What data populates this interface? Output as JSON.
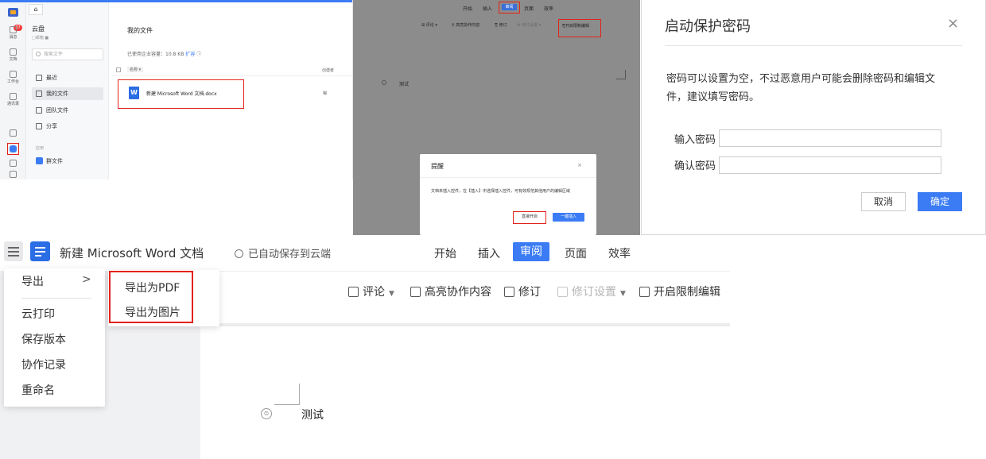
{
  "p1": {
    "rail": {
      "badge": "37",
      "items": [
        "消息",
        "文档",
        "工作台",
        "通讯录"
      ]
    },
    "home_tab": "⌂",
    "side": {
      "title": "云盘",
      "sub": "□邮箱 ■",
      "search_placeholder": "搜索文件",
      "nav": [
        "最近",
        "我的文件",
        "团队文件",
        "分享"
      ],
      "apps_label": "应用",
      "group_file": "群文件"
    },
    "main": {
      "title": "我的文件",
      "quota": "已使用企业容量：10.8 KB",
      "expand": "扩容",
      "col_name": "名称",
      "col_creator": "创建者",
      "file_name": "新建 Microsoft Word 文档.docx",
      "file_icon": "W",
      "file_owner": "锡"
    }
  },
  "p2": {
    "tabs": [
      "开始",
      "插入",
      "审阅",
      "页面",
      "效率"
    ],
    "tools": [
      "评论",
      "高亮协作内容",
      "修订",
      "修订设置",
      "开启限制编辑"
    ],
    "test": "测试",
    "dialog": {
      "title": "提醒",
      "close": "×",
      "message": "文档未插入控件，在【插入】中选择插入控件，可有效规范其他用户的编辑区域",
      "btn_direct": "直接开启",
      "btn_insert": "一键插入"
    }
  },
  "p3": {
    "title": "启动保护密码",
    "close": "×",
    "message": "密码可以设置为空，不过恶意用户可能会删除密码和编辑文件，建议填写密码。",
    "label_password": "输入密码",
    "label_confirm": "确认密码",
    "password_value": "",
    "confirm_value": "",
    "cancel": "取消",
    "ok": "确定"
  },
  "p4": {
    "doc_title": "新建 Microsoft Word 文档",
    "autosave": "已自动保存到云端",
    "tabs": [
      "开始",
      "插入",
      "审阅",
      "页面",
      "效率"
    ],
    "tools": {
      "comment": "评论",
      "highlight": "高亮协作内容",
      "revise": "修订",
      "revise_settings": "修订设置",
      "restrict": "开启限制编辑"
    },
    "menu": {
      "export": "导出",
      "arrow": ">",
      "cloud_print": "云打印",
      "save_version": "保存版本",
      "collab_log": "协作记录",
      "rename": "重命名"
    },
    "submenu": {
      "pdf": "导出为PDF",
      "image": "导出为图片"
    },
    "test": "测试",
    "para_icon": "⊜"
  },
  "colors": {
    "accent": "#3b7cf5",
    "highlight_red": "#e2231a"
  }
}
